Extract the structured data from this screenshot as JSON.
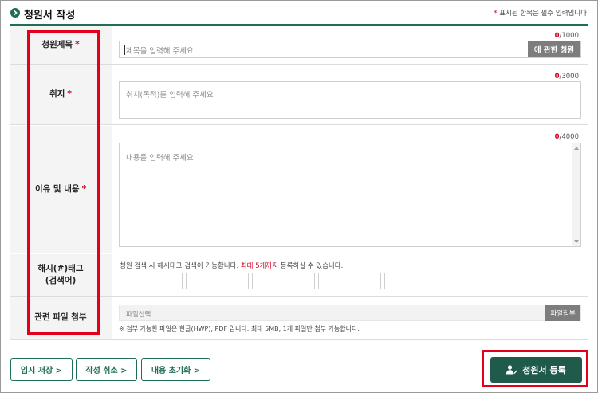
{
  "header": {
    "title": "청원서 작성",
    "required_note_star": "*",
    "required_note": "표시된 항목은 필수 입력입니다"
  },
  "form": {
    "title_row": {
      "label": "청원제목",
      "required": "*",
      "counter_current": "0",
      "counter_max": "/1000",
      "placeholder": "제목을 입력해 주세요",
      "about_button": "에 관한 청원"
    },
    "purpose_row": {
      "label": "취지",
      "required": "*",
      "counter_current": "0",
      "counter_max": "/3000",
      "placeholder": "취지(목적)를 입력해 주세요"
    },
    "content_row": {
      "label": "이유 및 내용",
      "required": "*",
      "counter_current": "0",
      "counter_max": "/4000",
      "placeholder": "내용을 입력해 주세요"
    },
    "hashtag_row": {
      "label_line1": "해시(#)태그",
      "label_line2": "(검색어)",
      "hint_before": "청원 검색 시 해시태그 검색이 가능합니다.",
      "hint_highlight": "최대 5개까지",
      "hint_after": "등록하실 수 있습니다."
    },
    "file_row": {
      "label": "관련 파일 첨부",
      "placeholder": "파일선택",
      "attach_button": "파일첨부",
      "note": "※ 첨부 가능한 파일은 한글(HWP), PDF 입니다. 최대 5MB, 1개 파일만 첨부 가능합니다."
    }
  },
  "actions": {
    "temp_save": "임시 저장 >",
    "cancel": "작성 취소 >",
    "reset": "내용 초기화 >",
    "submit": "청원서 등록"
  },
  "colors": {
    "brand": "#1f6e57",
    "submit_bg": "#1f5a4a",
    "required": "#d1001f",
    "highlight": "#e3001b"
  }
}
